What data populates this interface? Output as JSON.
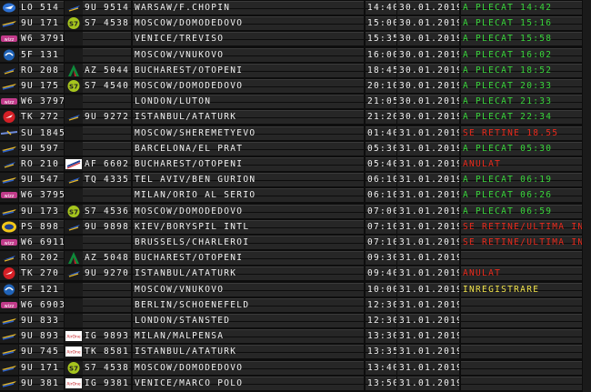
{
  "colors": {
    "green": "#39d63b",
    "red": "#ea2a1c",
    "yellow": "#f0e24a",
    "text": "#f2f2f2"
  },
  "rows": [
    {
      "logo1": "lot-icon",
      "flight1": "LO 514",
      "logo2": "tarom-icon",
      "flight2": "9U 9514",
      "dest": "WARSAW/F.CHOPIN",
      "time": "14:40",
      "date": "30.01.2019",
      "status": "A PLECAT 14:42",
      "status_color": "green"
    },
    {
      "logo1": "air-moldova-icon",
      "flight1": "9U 171",
      "logo2": "s7-icon",
      "flight2": "S7 4538",
      "dest": "MOSCOW/DOMODEDOVO",
      "time": "15:00",
      "date": "30.01.2019",
      "status": "A PLECAT 15:16",
      "status_color": "green"
    },
    {
      "logo1": "wizz-icon",
      "flight1": "W6 3791",
      "logo2": "",
      "flight2": "",
      "dest": "VENICE/TREVISO",
      "time": "15:35",
      "date": "30.01.2019",
      "status": "A PLECAT 15:58",
      "status_color": "green"
    },
    {
      "logo1": "pobeda-icon",
      "flight1": "5F 131",
      "logo2": "",
      "flight2": "",
      "dest": "MOSCOW/VNUKOVO",
      "time": "16:00",
      "date": "30.01.2019",
      "status": "A PLECAT 16:02",
      "status_color": "green"
    },
    {
      "logo1": "tarom-icon",
      "flight1": "RO 208",
      "logo2": "alitalia-icon",
      "flight2": "AZ 5044",
      "dest": "BUCHAREST/OTOPENI",
      "time": "18:45",
      "date": "30.01.2019",
      "status": "A PLECAT 18:52",
      "status_color": "green"
    },
    {
      "logo1": "air-moldova-icon",
      "flight1": "9U 175",
      "logo2": "s7-icon",
      "flight2": "S7 4540",
      "dest": "MOSCOW/DOMODEDOVO",
      "time": "20:10",
      "date": "30.01.2019",
      "status": "A PLECAT 20:33",
      "status_color": "green"
    },
    {
      "logo1": "wizz-icon",
      "flight1": "W6 3797",
      "logo2": "",
      "flight2": "",
      "dest": "LONDON/LUTON",
      "time": "21:05",
      "date": "30.01.2019",
      "status": "A PLECAT 21:33",
      "status_color": "green"
    },
    {
      "logo1": "turkish-icon",
      "flight1": "TK 272",
      "logo2": "tarom-icon",
      "flight2": "9U 9272",
      "dest": "ISTANBUL/ATATURK",
      "time": "21:20",
      "date": "30.01.2019",
      "status": "A PLECAT 22:34",
      "status_color": "green"
    },
    {
      "logo1": "aeroflot-icon",
      "flight1": "SU 1845",
      "logo2": "",
      "flight2": "",
      "dest": "MOSCOW/SHEREMETYEVO",
      "time": "01:40",
      "date": "31.01.2019",
      "status": "SE RETINE 18.55",
      "status_color": "red"
    },
    {
      "logo1": "air-moldova-icon",
      "flight1": "9U 597",
      "logo2": "",
      "flight2": "",
      "dest": "BARCELONA/EL PRAT",
      "time": "05:30",
      "date": "31.01.2019",
      "status": "A PLECAT 05:30",
      "status_color": "green"
    },
    {
      "logo1": "tarom-icon",
      "flight1": "RO 210",
      "logo2": "air-france-icon",
      "flight2": "AF 6602",
      "dest": "BUCHAREST/OTOPENI",
      "time": "05:40",
      "date": "31.01.2019",
      "status": "ANULAT",
      "status_color": "red"
    },
    {
      "logo1": "air-moldova-icon",
      "flight1": "9U 547",
      "logo2": "tarom-icon",
      "flight2": "TQ 4335",
      "dest": "TEL AVIV/BEN GURION",
      "time": "06:10",
      "date": "31.01.2019",
      "status": "A PLECAT 06:19",
      "status_color": "green"
    },
    {
      "logo1": "wizz-icon",
      "flight1": "W6 3795",
      "logo2": "",
      "flight2": "",
      "dest": "MILAN/ORIO AL SERIO",
      "time": "06:10",
      "date": "31.01.2019",
      "status": "A PLECAT 06:26",
      "status_color": "green"
    },
    {
      "logo1": "air-moldova-icon",
      "flight1": "9U 173",
      "logo2": "s7-icon",
      "flight2": "S7 4536",
      "dest": "MOSCOW/DOMODEDOVO",
      "time": "07:00",
      "date": "31.01.2019",
      "status": "A PLECAT 06:59",
      "status_color": "green"
    },
    {
      "logo1": "uia-icon",
      "flight1": "PS 898",
      "logo2": "tarom-icon",
      "flight2": "9U 9898",
      "dest": "KIEV/BORYSPIL INTL",
      "time": "07:10",
      "date": "31.01.2019",
      "status": "SE RETINE/ULTIMA INVI",
      "status_color": "red"
    },
    {
      "logo1": "wizz-icon",
      "flight1": "W6 6911",
      "logo2": "",
      "flight2": "",
      "dest": "BRUSSELS/CHARLEROI",
      "time": "07:10",
      "date": "31.01.2019",
      "status": "SE RETINE/ULTIMA INVI",
      "status_color": "red"
    },
    {
      "logo1": "tarom-icon",
      "flight1": "RO 202",
      "logo2": "alitalia-icon",
      "flight2": "AZ 5048",
      "dest": "BUCHAREST/OTOPENI",
      "time": "09:30",
      "date": "31.01.2019",
      "status": "",
      "status_color": "green"
    },
    {
      "logo1": "turkish-icon",
      "flight1": "TK 270",
      "logo2": "tarom-icon",
      "flight2": "9U 9270",
      "dest": "ISTANBUL/ATATURK",
      "time": "09:40",
      "date": "31.01.2019",
      "status": "ANULAT",
      "status_color": "red"
    },
    {
      "logo1": "pobeda-icon",
      "flight1": "5F 121",
      "logo2": "",
      "flight2": "",
      "dest": "MOSCOW/VNUKOVO",
      "time": "10:00",
      "date": "31.01.2019",
      "status": "INREGISTRARE",
      "status_color": "yellow"
    },
    {
      "logo1": "wizz-icon",
      "flight1": "W6 6903",
      "logo2": "",
      "flight2": "",
      "dest": "BERLIN/SCHOENEFELD",
      "time": "12:30",
      "date": "31.01.2019",
      "status": "",
      "status_color": "green"
    },
    {
      "logo1": "air-moldova-icon",
      "flight1": "9U 833",
      "logo2": "",
      "flight2": "",
      "dest": "LONDON/STANSTED",
      "time": "12:30",
      "date": "31.01.2019",
      "status": "",
      "status_color": "green"
    },
    {
      "logo1": "air-moldova-icon",
      "flight1": "9U 893",
      "logo2": "airone-icon",
      "flight2": "IG 9893",
      "dest": "MILAN/MALPENSA",
      "time": "13:30",
      "date": "31.01.2019",
      "status": "",
      "status_color": "green"
    },
    {
      "logo1": "air-moldova-icon",
      "flight1": "9U 745",
      "logo2": "airone-icon",
      "flight2": "TK 8581",
      "dest": "ISTANBUL/ATATURK",
      "time": "13:35",
      "date": "31.01.2019",
      "status": "",
      "status_color": "green"
    },
    {
      "logo1": "air-moldova-icon",
      "flight1": "9U 171",
      "logo2": "s7-icon",
      "flight2": "S7 4538",
      "dest": "MOSCOW/DOMODEDOVO",
      "time": "13:40",
      "date": "31.01.2019",
      "status": "",
      "status_color": "green"
    },
    {
      "logo1": "air-moldova-icon",
      "flight1": "9U 381",
      "logo2": "airone-icon",
      "flight2": "IG 9381",
      "dest": "VENICE/MARCO POLO",
      "time": "13:50",
      "date": "31.01.2019",
      "status": "",
      "status_color": "green"
    }
  ]
}
